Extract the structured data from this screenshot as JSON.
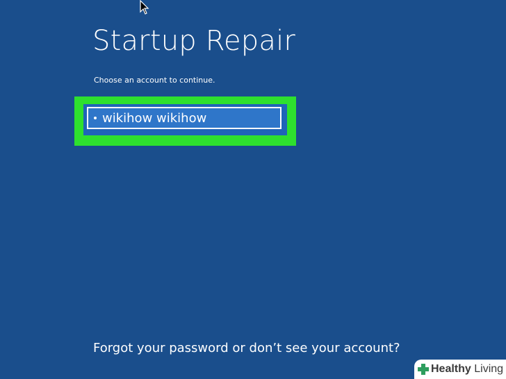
{
  "screen": {
    "title": "Startup Repair",
    "subtitle": "Choose an account to continue."
  },
  "account": {
    "name": "wikihow wikihow"
  },
  "footer": {
    "forgot_link": "Forgot your password or don’t see your account?"
  },
  "watermark": {
    "brand_bold": "Healthy",
    "brand_regular": " Living",
    "icon": "plus-cross-icon"
  },
  "colors": {
    "background": "#1a4e8c",
    "highlight": "#2ee02e",
    "tile": "#1f64b8",
    "watermark_icon": "#2e9e5e"
  },
  "cursor": {
    "icon": "mouse-pointer-icon"
  }
}
